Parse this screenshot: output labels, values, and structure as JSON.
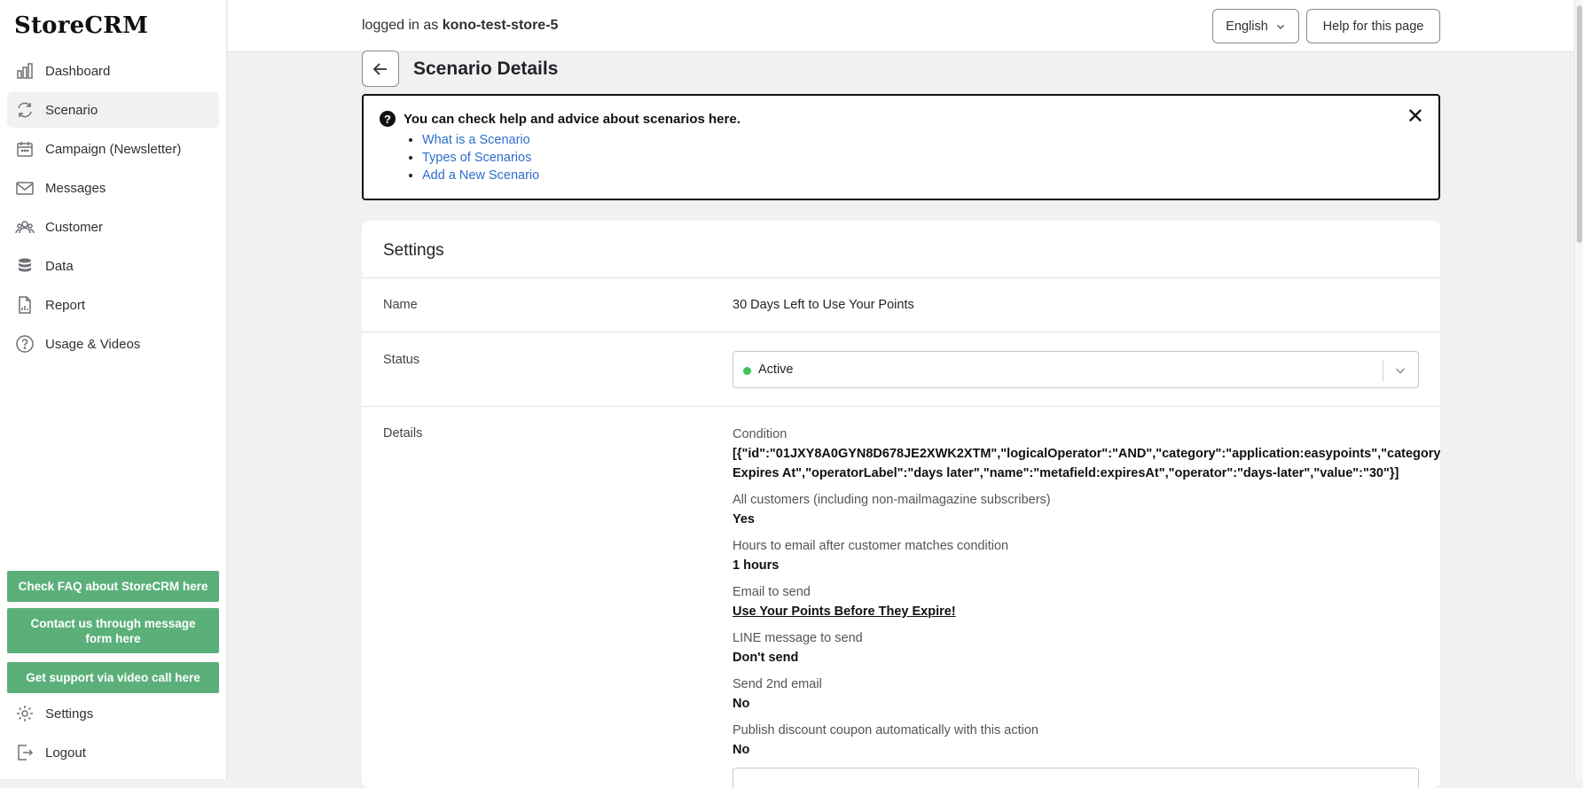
{
  "app": {
    "name": "StoreCRM"
  },
  "sidebar": {
    "items": [
      {
        "label": "Dashboard",
        "icon": "bar-chart-icon"
      },
      {
        "label": "Scenario",
        "icon": "refresh-icon",
        "active": true
      },
      {
        "label": "Campaign (Newsletter)",
        "icon": "calendar-icon"
      },
      {
        "label": "Messages",
        "icon": "envelope-icon"
      },
      {
        "label": "Customer",
        "icon": "users-icon"
      },
      {
        "label": "Data",
        "icon": "database-icon"
      },
      {
        "label": "Report",
        "icon": "document-icon"
      },
      {
        "label": "Usage & Videos",
        "icon": "question-circle-icon"
      }
    ],
    "support_buttons": [
      "Check FAQ about StoreCRM here",
      "Contact us through message form here",
      "Get support via video call here"
    ],
    "bottom_items": [
      {
        "label": "Settings",
        "icon": "gear-icon"
      },
      {
        "label": "Logout",
        "icon": "logout-icon"
      }
    ],
    "support_color": "#5bb07a"
  },
  "topbar": {
    "logged_prefix": "logged in as",
    "username": "kono-test-store-5",
    "language": "English",
    "help_button": "Help for this page"
  },
  "page": {
    "title": "Scenario Details"
  },
  "helpbox": {
    "title": "You can check help and advice about scenarios here.",
    "links": [
      "What is a Scenario",
      "Types of Scenarios",
      "Add a New Scenario"
    ]
  },
  "settings": {
    "title": "Settings",
    "name_label": "Name",
    "name_value": "30 Days Left to Use Your Points",
    "status_label": "Status",
    "status_value": "Active",
    "status_color": "#3fbf5d",
    "details_label": "Details",
    "details": {
      "condition_label": "Condition",
      "condition_line1": "[{\"id\":\"01JXY8A0GYN8D678JE2XWK2XTM\",\"logicalOperator\":\"AND\",\"category\":\"application:easypoints\",\"category",
      "condition_line2": "Expires At\",\"operatorLabel\":\"days later\",\"name\":\"metafield:expiresAt\",\"operator\":\"days-later\",\"value\":\"30\"}]",
      "all_customers_label": "All customers (including non-mailmagazine subscribers)",
      "all_customers_value": "Yes",
      "hours_label": "Hours to email after customer matches condition",
      "hours_value": "1 hours",
      "email_label": "Email to send",
      "email_value": "Use Your Points Before They Expire!",
      "line_label": "LINE message to send",
      "line_value": "Don't send",
      "second_email_label": "Send 2nd email",
      "second_email_value": "No",
      "coupon_label": "Publish discount coupon automatically with this action",
      "coupon_value": "No"
    }
  }
}
